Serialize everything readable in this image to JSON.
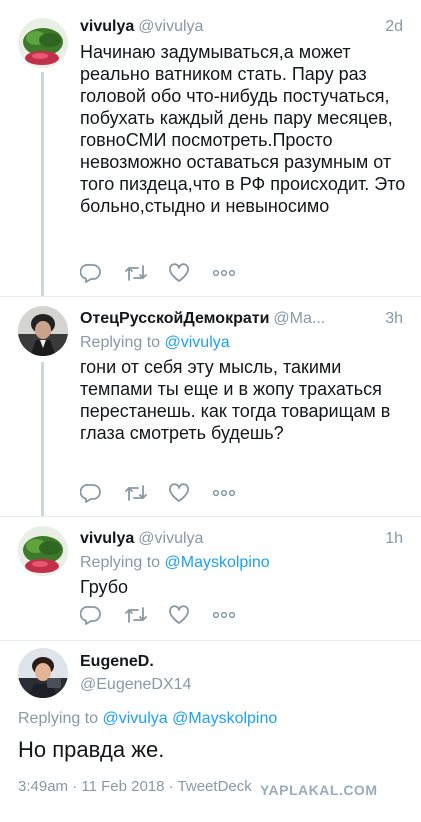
{
  "tweets": [
    {
      "name": "vivulya",
      "handle": "@vivulya",
      "time": "2d",
      "text": "Начинаю задумываться,а может реально ватником стать. Пару раз головой обо что-нибудь постучаться, побухать каждый день пару месяцев, говноСМИ посмотреть.Просто невозможно оставаться разумным от того пиздеца,что в РФ происходит. Это больно,стыдно и невыносимо"
    },
    {
      "name": "ОтецРусскойДемократи",
      "handle": "@Ma...",
      "time": "3h",
      "replying_label": "Replying to",
      "replying_to": "@vivulya",
      "text": "гони от себя эту мысль, такими темпами ты еще и в жопу трахаться перестанешь. как тогда товарищам в глаза смотреть будешь?"
    },
    {
      "name": "vivulya",
      "handle": "@vivulya",
      "time": "1h",
      "replying_label": "Replying to",
      "replying_to": "@Mayskolpino",
      "text": "Грубо"
    }
  ],
  "main_tweet": {
    "name": "EugeneD.",
    "handle": "@EugeneDX14",
    "replying_label": "Replying to",
    "replying_to_1": "@vivulya",
    "replying_to_2": "@Mayskolpino",
    "text": "Но правда же.",
    "meta": "3:49am · 11 Feb 2018 · TweetDeck"
  },
  "watermark": "YAPLAKAL.COM",
  "colors": {
    "link": "#1da1f2",
    "muted": "#8899a6",
    "divider": "#e6ecf0"
  },
  "icons": [
    "reply-icon",
    "retweet-icon",
    "like-icon",
    "more-icon"
  ]
}
